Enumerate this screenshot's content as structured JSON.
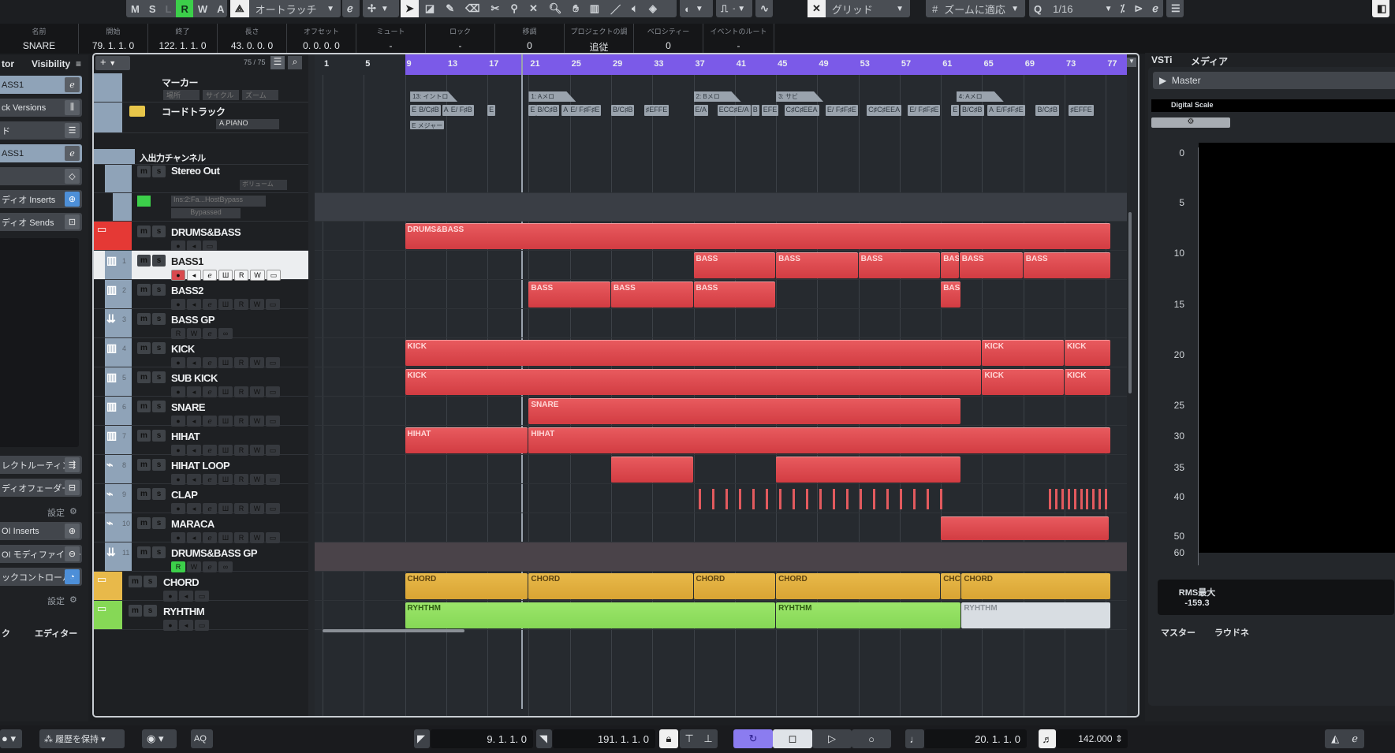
{
  "toolbar": {
    "mode_buttons": [
      "M",
      "S",
      "L",
      "R",
      "W",
      "A"
    ],
    "active_mode": "R",
    "automation_mode": "オートラッチ",
    "snap_type": "グリッド",
    "grid_type": "ズームに適応",
    "quantize": "1/16",
    "quantize_icon": "Q"
  },
  "infoline": {
    "fields": [
      {
        "label": "名前",
        "value": "SNARE"
      },
      {
        "label": "開始",
        "value": "79. 1. 1.   0"
      },
      {
        "label": "終了",
        "value": "122. 1. 1.   0"
      },
      {
        "label": "長さ",
        "value": "43. 0. 0.   0"
      },
      {
        "label": "オフセット",
        "value": "0. 0. 0.   0"
      },
      {
        "label": "ミュート",
        "value": "-"
      },
      {
        "label": "ロック",
        "value": "-"
      },
      {
        "label": "移調",
        "value": "0"
      },
      {
        "label": "プロジェクトの調",
        "value": "追従"
      },
      {
        "label": "ベロシティー",
        "value": "0"
      },
      {
        "label": "イベントのルート",
        "value": "-"
      }
    ]
  },
  "inspector": {
    "tabs": [
      "tor",
      "Visibility"
    ],
    "rows": [
      {
        "label": "ASS1",
        "icon": "e",
        "selected": true
      },
      {
        "label": "ck Versions",
        "icon": "versions"
      },
      {
        "label": "ド",
        "icon": "eq"
      },
      {
        "label": "ASS1",
        "icon": "e",
        "selected": true
      },
      {
        "label": "",
        "icon": "diamond"
      },
      {
        "label": "ディオ Inserts",
        "icon": "insert",
        "active": true
      },
      {
        "label": "ディオ Sends",
        "icon": "send"
      }
    ],
    "rows2": [
      {
        "label": "レクトルーティング",
        "icon": "route"
      },
      {
        "label": "ディオフェーダー",
        "icon": "fader"
      },
      {
        "label": "OI Inserts",
        "icon": "insert"
      },
      {
        "label": "OI モディファイアー",
        "icon": "modifier"
      },
      {
        "label": "ックコントロール",
        "icon": "knob",
        "active": true
      }
    ],
    "settings_label": "設定",
    "bottom_tabs": [
      "ク",
      "エディター"
    ]
  },
  "project": {
    "track_count": "75 / 75",
    "ruler_ticks": [
      "1",
      "5",
      "9",
      "13",
      "17",
      "21",
      "25",
      "29",
      "33",
      "37",
      "41",
      "45",
      "49",
      "53",
      "57",
      "61",
      "65",
      "69",
      "73",
      "77"
    ],
    "marker_track": {
      "name": "マーカー",
      "buttons": [
        "場所",
        "サイクル",
        "ズーム"
      ]
    },
    "chord_track": {
      "name": "コードトラック",
      "instrument": "A.PIANO"
    },
    "io_folder": "入出力チャンネル",
    "stereo_out": {
      "name": "Stereo Out",
      "volume": "ボリューム"
    },
    "insert_auto": {
      "plugin": "Ins:2:Fa...HostBypass",
      "state": "Bypassed"
    },
    "tracks": [
      {
        "num": "",
        "name": "DRUMS&BASS",
        "type": "folder",
        "color": "#e53935"
      },
      {
        "num": "1",
        "name": "BASS1",
        "type": "midi",
        "selected": true
      },
      {
        "num": "2",
        "name": "BASS2",
        "type": "midi"
      },
      {
        "num": "3",
        "name": "BASS GP",
        "type": "group"
      },
      {
        "num": "4",
        "name": "KICK",
        "type": "midi"
      },
      {
        "num": "5",
        "name": "SUB KICK",
        "type": "midi"
      },
      {
        "num": "6",
        "name": "SNARE",
        "type": "midi"
      },
      {
        "num": "7",
        "name": "HIHAT",
        "type": "midi"
      },
      {
        "num": "8",
        "name": "HIHAT LOOP",
        "type": "audio"
      },
      {
        "num": "9",
        "name": "CLAP",
        "type": "audio"
      },
      {
        "num": "10",
        "name": "MARACA",
        "type": "audio"
      },
      {
        "num": "11",
        "name": "DRUMS&BASS GP",
        "type": "group"
      },
      {
        "num": "",
        "name": "CHORD",
        "type": "folder",
        "color": "#e8b94a"
      },
      {
        "num": "",
        "name": "RYHTHM",
        "type": "folder",
        "color": "#86d856"
      }
    ],
    "markers": [
      {
        "label": "13: イントロ",
        "bar": 9.5
      },
      {
        "label": "1: Aメロ",
        "bar": 21
      },
      {
        "label": "2: Bメロ",
        "bar": 37
      },
      {
        "label": "3: サビ",
        "bar": 45
      },
      {
        "label": "4: Aメロ",
        "bar": 62.5
      }
    ],
    "chords": [
      {
        "t": "E",
        "b": 9.5
      },
      {
        "t": "B/C♯B",
        "b": 10.2
      },
      {
        "t": "A",
        "b": 12.6
      },
      {
        "t": "E/ F♯B",
        "b": 13.3
      },
      {
        "t": "E",
        "b": 17
      },
      {
        "t": "E",
        "b": 21
      },
      {
        "t": "B/C♯B",
        "b": 21.7
      },
      {
        "t": "A",
        "b": 24.2
      },
      {
        "t": "E/ F♯F♯E",
        "b": 24.9
      },
      {
        "t": "B/C♯B",
        "b": 29
      },
      {
        "t": "♯EFFE",
        "b": 32.2
      },
      {
        "t": "E/A",
        "b": 37
      },
      {
        "t": "ECC♯E/A",
        "b": 39.3
      },
      {
        "t": "B",
        "b": 42.6
      },
      {
        "t": "EFE",
        "b": 43.6
      },
      {
        "t": "C♯C♯EEA",
        "b": 45.8
      },
      {
        "t": "E/ F♯F♯E",
        "b": 49.8
      },
      {
        "t": "C♯C♯EEA",
        "b": 53.8
      },
      {
        "t": "E/ F♯F♯E",
        "b": 57.8
      },
      {
        "t": "E",
        "b": 62
      },
      {
        "t": "B/C♯B",
        "b": 62.9
      },
      {
        "t": "A",
        "b": 65.5
      },
      {
        "t": "E/F♯F♯E",
        "b": 66.2
      },
      {
        "t": "B/C♯B",
        "b": 70.2
      },
      {
        "t": "♯EFFE",
        "b": 73.4
      }
    ],
    "scale_event": "E メジャー",
    "parts": [
      {
        "lane": 0,
        "label": "DRUMS&BASS",
        "start": 9,
        "end": 77.5,
        "color": "red"
      },
      {
        "lane": 1,
        "label": "BASS",
        "start": 37,
        "end": 45,
        "color": "red"
      },
      {
        "lane": 1,
        "label": "BASS",
        "start": 45,
        "end": 53,
        "color": "red"
      },
      {
        "lane": 1,
        "label": "BASS",
        "start": 53,
        "end": 61,
        "color": "red"
      },
      {
        "lane": 1,
        "label": "BAS",
        "start": 61,
        "end": 62.8,
        "color": "red"
      },
      {
        "lane": 1,
        "label": "BASS",
        "start": 62.8,
        "end": 69,
        "color": "red"
      },
      {
        "lane": 1,
        "label": "BASS",
        "start": 69,
        "end": 77.5,
        "color": "red"
      },
      {
        "lane": 2,
        "label": "BASS",
        "start": 21,
        "end": 29,
        "color": "red"
      },
      {
        "lane": 2,
        "label": "BASS",
        "start": 29,
        "end": 37,
        "color": "red"
      },
      {
        "lane": 2,
        "label": "BASS",
        "start": 37,
        "end": 45,
        "color": "red"
      },
      {
        "lane": 2,
        "label": "BAS",
        "start": 61,
        "end": 63,
        "color": "red"
      },
      {
        "lane": 4,
        "label": "KICK",
        "start": 9,
        "end": 65,
        "color": "red"
      },
      {
        "lane": 4,
        "label": "KICK",
        "start": 65,
        "end": 73,
        "color": "red"
      },
      {
        "lane": 4,
        "label": "KICK",
        "start": 73,
        "end": 77.5,
        "color": "red"
      },
      {
        "lane": 5,
        "label": "KICK",
        "start": 9,
        "end": 65,
        "color": "red"
      },
      {
        "lane": 5,
        "label": "KICK",
        "start": 65,
        "end": 73,
        "color": "red"
      },
      {
        "lane": 5,
        "label": "KICK",
        "start": 73,
        "end": 77.5,
        "color": "red"
      },
      {
        "lane": 6,
        "label": "SNARE",
        "start": 21,
        "end": 63,
        "color": "red"
      },
      {
        "lane": 7,
        "label": "HIHAT",
        "start": 9,
        "end": 21,
        "color": "red"
      },
      {
        "lane": 7,
        "label": "HIHAT",
        "start": 21,
        "end": 77.5,
        "color": "red"
      },
      {
        "lane": 8,
        "label": "",
        "start": 29,
        "end": 37,
        "color": "red"
      },
      {
        "lane": 8,
        "label": "",
        "start": 45,
        "end": 63,
        "color": "red"
      },
      {
        "lane": 12,
        "label": "CHORD",
        "start": 9,
        "end": 21,
        "color": "yel"
      },
      {
        "lane": 12,
        "label": "CHORD",
        "start": 21,
        "end": 37,
        "color": "yel"
      },
      {
        "lane": 12,
        "label": "CHORD",
        "start": 37,
        "end": 45,
        "color": "yel"
      },
      {
        "lane": 12,
        "label": "CHORD",
        "start": 45,
        "end": 61,
        "color": "yel"
      },
      {
        "lane": 12,
        "label": "CHC",
        "start": 61,
        "end": 63,
        "color": "yel"
      },
      {
        "lane": 12,
        "label": "CHORD",
        "start": 63,
        "end": 77.5,
        "color": "yel"
      },
      {
        "lane": 13,
        "label": "RYHTHM",
        "start": 9,
        "end": 45,
        "color": "grn"
      },
      {
        "lane": 13,
        "label": "RYHTHM",
        "start": 45,
        "end": 63,
        "color": "grn"
      },
      {
        "lane": 13,
        "label": "RYHTHM",
        "start": 63,
        "end": 77.5,
        "color": "gry"
      }
    ]
  },
  "rightzone": {
    "tabs": [
      "VSTi",
      "メディア"
    ],
    "master_label": "Master",
    "meter_type": "Digital Scale",
    "scale": [
      "0",
      "5",
      "10",
      "15",
      "20",
      "25",
      "30",
      "35",
      "40",
      "50",
      "60"
    ],
    "rms_label": "RMS最大",
    "rms_value": "-159.3",
    "bottom_tabs": [
      "マスター",
      "ラウドネ"
    ]
  },
  "transport": {
    "history": "履歴を保持",
    "aq": "AQ",
    "left_locator": "9. 1. 1.   0",
    "right_locator": "191. 1. 1.   0",
    "position": "20. 1. 1.   0",
    "tempo": "142.000"
  }
}
